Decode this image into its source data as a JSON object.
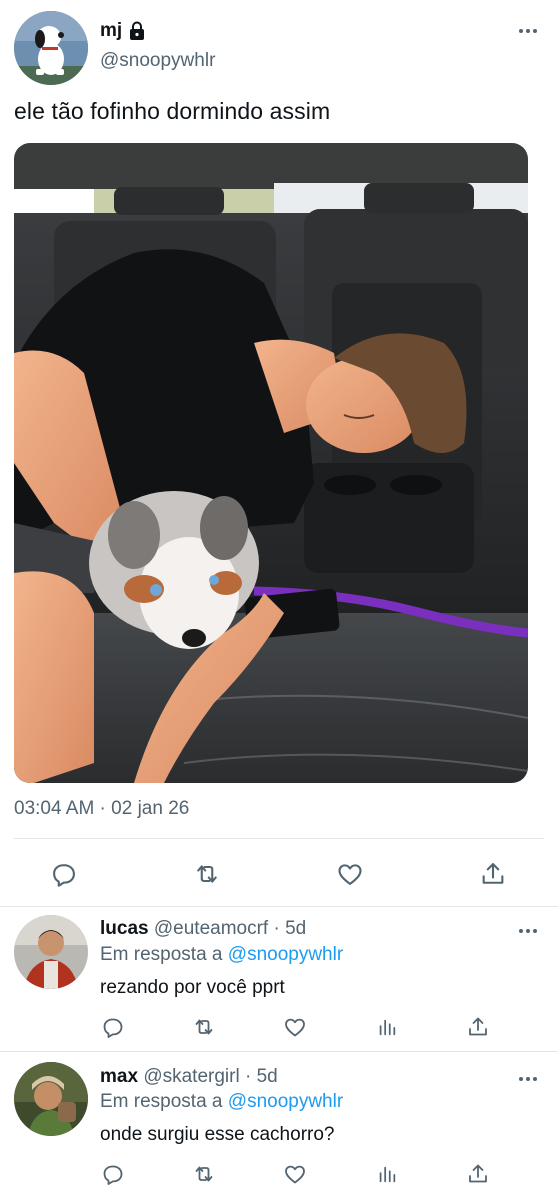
{
  "tweet": {
    "author_name": "mj",
    "author_handle": "@snoopywhlr",
    "text": "ele tão fofinho dormindo assim",
    "timestamp": "03:04 AM · 02 jan 26",
    "icons": {
      "lock": "lock-icon",
      "more": "more-icon",
      "reply": "reply-icon",
      "retweet": "retweet-icon",
      "like": "heart-icon",
      "share": "share-icon"
    }
  },
  "replies": [
    {
      "name": "lucas",
      "handle": "@euteamocrf",
      "time": "5d",
      "reply_prefix": "Em resposta a",
      "reply_mention": "@snoopywhlr",
      "text": "rezando por você pprt"
    },
    {
      "name": "max",
      "handle": "@skatergirl",
      "time": "5d",
      "reply_prefix": "Em resposta a",
      "reply_mention": "@snoopywhlr",
      "text": "onde surgiu esse cachorro?"
    }
  ],
  "colors": {
    "text": "#0f1419",
    "secondary": "#536471",
    "link": "#1d9bf0",
    "divider": "#e3e6e8"
  }
}
